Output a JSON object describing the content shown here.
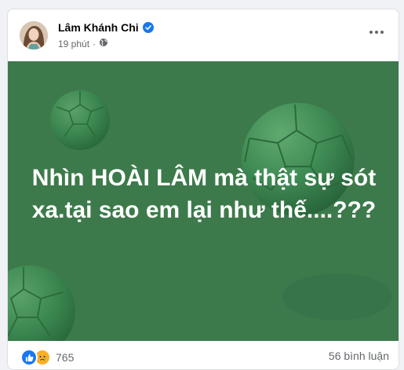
{
  "post": {
    "author_name": "Lâm Khánh Chi",
    "timestamp": "19 phút",
    "separator": "·",
    "text_line1": "Nhìn HOÀI LÂM mà thật sự sót",
    "text_line2": "xa.tại sao em lại như thế....???",
    "background_color": "#3d7a4b",
    "reaction_count": "765",
    "comment_count": "56 bình luận",
    "reactions": [
      "like",
      "sad"
    ],
    "icons": [
      "verified-badge-icon",
      "globe-icon",
      "more-options-icon",
      "like-reaction-icon",
      "sad-reaction-icon"
    ]
  }
}
